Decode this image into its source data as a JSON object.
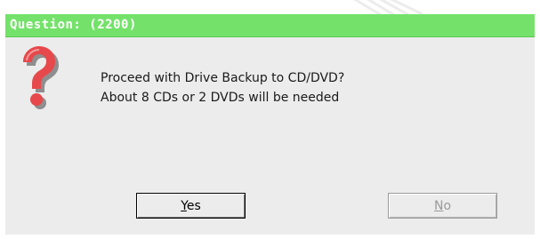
{
  "dialog": {
    "title": "Question: (2200)",
    "message_lines": [
      "Proceed with Drive Backup to CD/DVD?",
      "About 8 CDs or 2 DVDs will be needed"
    ],
    "icon": "question-mark-icon"
  },
  "buttons": {
    "yes": {
      "label_first": "Y",
      "label_rest": "es",
      "enabled": true
    },
    "no": {
      "label_first": "N",
      "label_rest": "o",
      "enabled": false
    }
  },
  "colors": {
    "title_bar": "#74e26a",
    "dialog_bg": "#ececec",
    "icon_red": "#e7484b",
    "icon_shadow": "#8e8e8e"
  }
}
